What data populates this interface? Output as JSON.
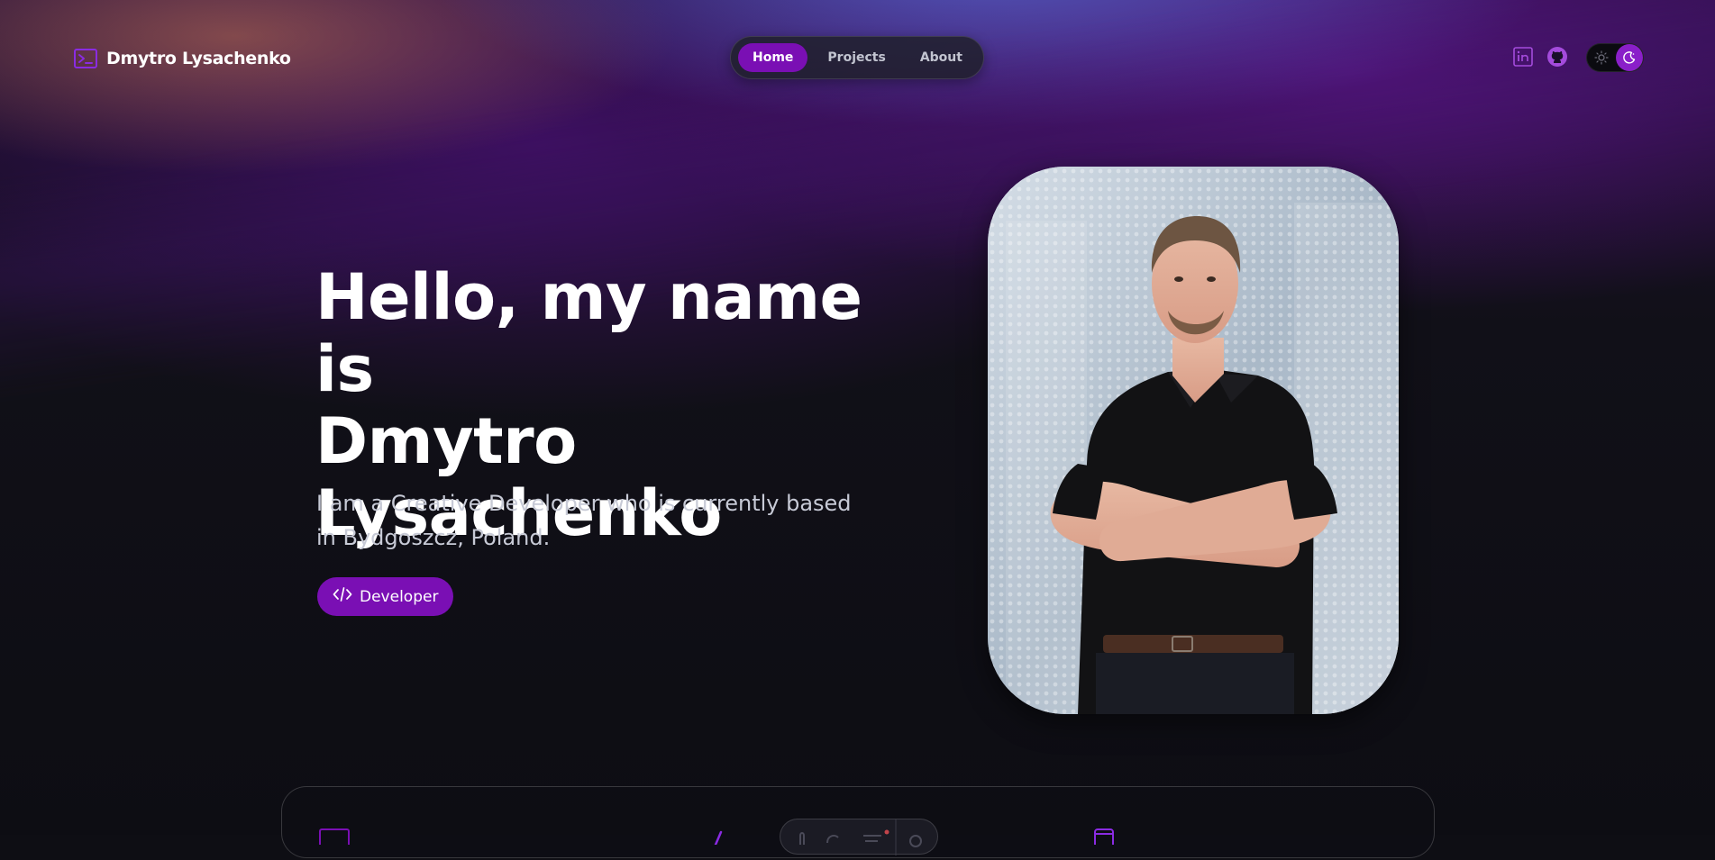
{
  "header": {
    "brand_name": "Dmytro Lysachenko",
    "brand_icon": "terminal-icon",
    "nav": [
      {
        "label": "Home",
        "active": true
      },
      {
        "label": "Projects",
        "active": false
      },
      {
        "label": "About",
        "active": false
      }
    ],
    "social_icons": [
      "linkedin-icon",
      "github-icon"
    ],
    "theme_toggle": {
      "mode": "dark",
      "icons": [
        "sun-icon",
        "moon-icon"
      ]
    }
  },
  "hero": {
    "title_line1": "Hello, my name is",
    "title_line2": "Dmytro",
    "title_line3": "Lysachenko",
    "subtitle": "I am a Creative Developer who is currently based in Bydgoszcz, Poland.",
    "badge_label": "Developer",
    "badge_icon": "code-icon",
    "portrait_icon": "portrait-photo"
  },
  "colors": {
    "accent": "#7a0fb4",
    "background": "#0e0e14",
    "text": "#ffffff",
    "muted_text": "#c7cad6"
  }
}
